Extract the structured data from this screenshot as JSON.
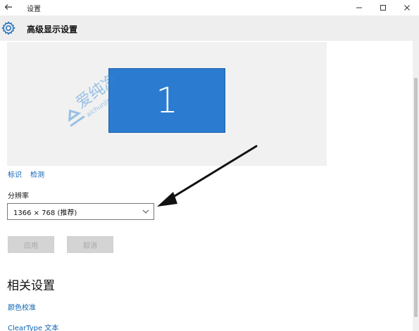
{
  "window": {
    "title": "设置",
    "back_icon": "back-arrow-icon",
    "controls": [
      "minimize-icon",
      "maximize-icon",
      "close-icon"
    ]
  },
  "header": {
    "icon": "gear-icon",
    "title": "高级显示设置"
  },
  "display_preview": {
    "monitor_number": "1",
    "monitor_color": "#2b7cd0",
    "background_color": "#f1f1f1"
  },
  "links": {
    "identify": "标识",
    "detect": "检测"
  },
  "resolution": {
    "label": "分辨率",
    "selected": "1366 × 768 (推荐)"
  },
  "buttons": {
    "apply": "应用",
    "cancel": "取消"
  },
  "related_settings": {
    "heading": "相关设置",
    "items": [
      "颜色校准",
      "ClearType 文本"
    ]
  },
  "watermark": {
    "text": "爱纯净",
    "subtext": "aichunjing"
  },
  "colors": {
    "accent": "#0a63b4",
    "header_bg": "#eeeeee",
    "button_disabled_bg": "#d4d4d4"
  }
}
